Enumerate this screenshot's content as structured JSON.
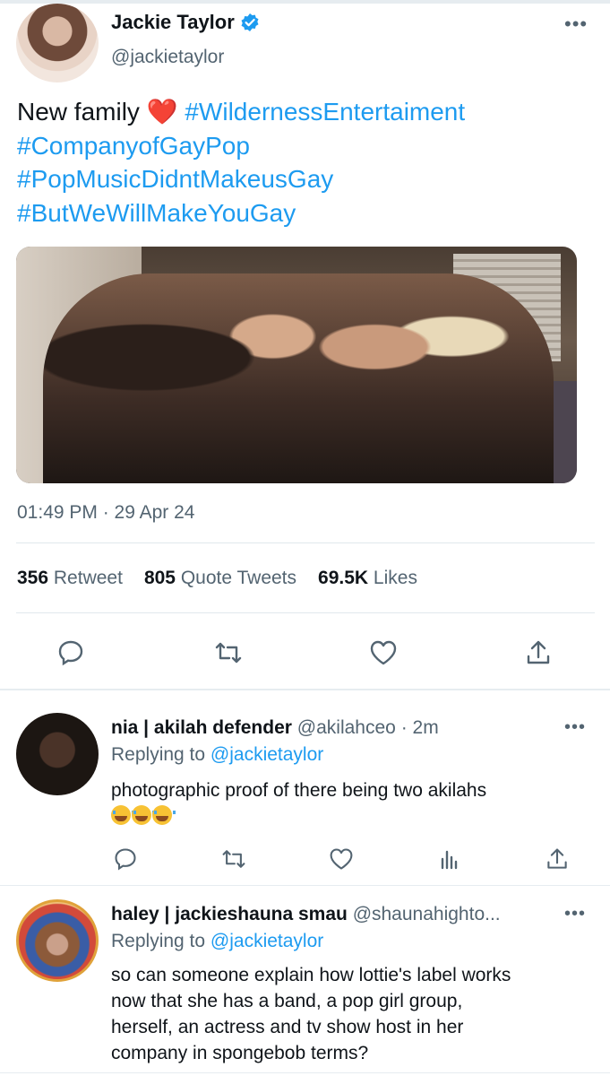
{
  "tweet": {
    "author_name": "Jackie Taylor",
    "author_handle": "@jackietaylor",
    "more_label": "•••",
    "text_prefix": "New family",
    "heart_emoji": "❤️",
    "hashtags": [
      "#WildernessEntertaiment",
      "#CompanyofGayPop",
      "#PopMusicDidntMakeusGay",
      "#ButWeWillMakeYouGay"
    ],
    "timestamp": "01:49 PM · 29 Apr 24",
    "stats": {
      "retweets_count": "356",
      "retweets_label": "Retweet",
      "quotes_count": "805",
      "quotes_label": "Quote Tweets",
      "likes_count": "69.5K",
      "likes_label": "Likes"
    },
    "actions": [
      "reply-icon",
      "retweet-icon",
      "like-icon",
      "share-icon"
    ]
  },
  "replies": [
    {
      "name": "nia | akilah defender",
      "handle": "@akilahceo",
      "time": "· 2m",
      "replying_prefix": "Replying to",
      "replying_to": "@jackietaylor",
      "text": "photographic proof of there being two akilahs",
      "emoji_count": "3",
      "more_label": "•••",
      "actions": [
        "reply-icon",
        "retweet-icon",
        "like-icon",
        "analytics-icon",
        "share-icon"
      ]
    },
    {
      "name": "haley | jackieshauna smau",
      "handle": "@shaunahighto...",
      "replying_prefix": "Replying to",
      "replying_to": "@jackietaylor",
      "text_lines": [
        "so can someone explain how lottie's label works",
        "now that she has a band, a pop girl group,",
        "herself, an actress and tv show host in her",
        "company in spongebob terms?"
      ],
      "more_label": "•••"
    }
  ],
  "colors": {
    "link": "#1d9bf0",
    "secondary_text": "#536471",
    "primary_text": "#0f1419",
    "verified": "#1d9bf0",
    "heart": "#e8457a"
  }
}
